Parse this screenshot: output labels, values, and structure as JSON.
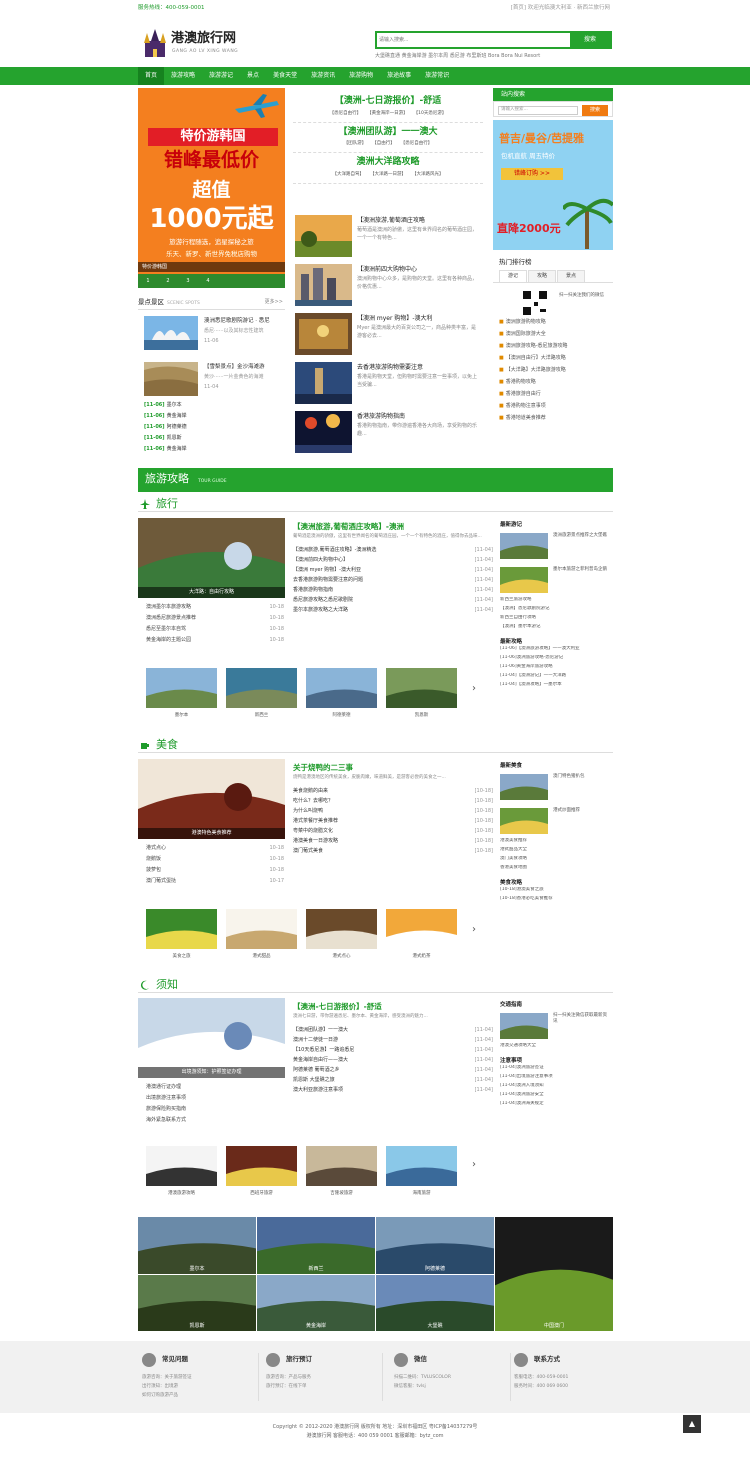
{
  "topbar": {
    "left": "服务热线：400-059-0001",
    "right": "[首页] 欢迎光临澳大利亚 · 新西兰旅行网"
  },
  "logo": {
    "cn": "港澳旅行网",
    "en": "GANG AO LV XING WANG"
  },
  "search": {
    "placeholder": "请输入搜索...",
    "button": "搜索",
    "hot": "大堡礁直通  黄金海岸游  墨尔本周  悉尼游  布里斯班  Bora Bora Nui Resort"
  },
  "nav": [
    "首页",
    "旅游攻略",
    "旅游游记",
    "景点",
    "美食天堂",
    "旅游资讯",
    "旅游购物",
    "旅途故事",
    "旅游常识"
  ],
  "banner": {
    "t1": "特价游韩国",
    "t2": "错峰最低价",
    "t3": "超值",
    "t4": "1000元起",
    "t5": "旅游行程随选，追星探秘之旅",
    "t6": "乐天、新罗、新世界免税店购物",
    "caption": "特价游韩国",
    "dots": [
      "1",
      "2",
      "3",
      "4"
    ]
  },
  "scenic": {
    "title": "景点景区",
    "en": "SCENIC SPOTS",
    "more": "更多>>",
    "items": [
      {
        "title": "澳洲悉尼歌剧院游记 · 悉尼",
        "desc": "悉尼······以及其标志性建筑",
        "date": "11-06"
      },
      {
        "title": "【雪梨景点】金沙海滩游",
        "desc": "黄沙······一片金黄色的海滩",
        "date": "11-04"
      }
    ],
    "list": [
      {
        "date": "[11-06]",
        "text": "墨尔本"
      },
      {
        "date": "[11-06]",
        "text": "黄金海岸"
      },
      {
        "date": "[11-06]",
        "text": "阿德莱德"
      },
      {
        "date": "[11-06]",
        "text": "凯恩斯"
      },
      {
        "date": "[11-06]",
        "text": "黄金海岸"
      }
    ]
  },
  "mid": {
    "blocks": [
      {
        "title": "【澳洲-七日游报价】-舒适",
        "subs": [
          "【悉尼自由行】",
          "【黄金海岸一日游】",
          "【10天悉尼游】"
        ]
      },
      {
        "title": "【澳洲团队游】一一澳大",
        "subs": [
          "【团队游】",
          "【自由行】",
          "【悉尼自由行】"
        ]
      },
      {
        "title": "澳洲大洋路攻略",
        "subs": [
          "【大洋路自驾】",
          "【大洋路一日游】",
          "【大洋路风光】"
        ]
      }
    ],
    "list": [
      {
        "title": "【澳洲旅游,葡萄酒庄攻略",
        "desc": "葡萄酒是澳洲的骄傲，这里有世界闻名的葡萄酒庄园，一个一个有特色..."
      },
      {
        "title": "【澳洲前四大购物中心",
        "desc": "澳洲购物中心众多，是购物的天堂。这里有各种商品，价格优惠..."
      },
      {
        "title": "【澳洲 myer 购物】-澳大利",
        "desc": "Myer 是澳洲最大的百货公司之一，商品种类丰富，是游客必去..."
      },
      {
        "title": "去香港旅游购物需要注意",
        "desc": "香港是购物天堂，但购物时需要注意一些事项，以免上当受骗..."
      },
      {
        "title": "香港旅游购物指南",
        "desc": "香港购物指南，带你游遍香港各大商场，享受购物的乐趣..."
      }
    ]
  },
  "right": {
    "search_title": "站内搜索",
    "search_ph": "请输入搜索...",
    "search_btn": "搜索",
    "ad_title": "普吉/曼谷/芭提雅",
    "ad_sub": "包机直航 周五特价",
    "ad_btn": "错峰订购 >>",
    "ad_price": "直降2000元",
    "rank_title": "热门排行榜",
    "tabs": [
      "游记",
      "攻略",
      "景点"
    ],
    "qr_text": "扫一扫关注我们的微信",
    "rank": [
      "澳洲旅游购物攻略",
      "澳洲国际旅游大全",
      "澳洲旅游攻略-悉尼旅游攻略",
      "【澳洲自由行】大洋路攻略",
      "【大洋路】大洋路旅游攻略",
      "香港购物攻略",
      "香港旅游自由行",
      "香港购物注意事项",
      "香港地道美食推荐"
    ]
  },
  "tourguide": {
    "title": "旅游攻略",
    "en": "TOUR GUIDE"
  },
  "cats": [
    {
      "name": "旅行",
      "img_cap": "大洋路：自由行攻略",
      "list": [
        {
          "t": "澳洲墨尔本旅游攻略",
          "d": "10-18"
        },
        {
          "t": "澳洲悉尼旅游景点推荐",
          "d": "10-18"
        },
        {
          "t": "悉尼至墨尔本自驾",
          "d": "10-18"
        },
        {
          "t": "黄金海岸的主题公园",
          "d": "10-18"
        }
      ],
      "center_title": "【澳洲旅游,葡萄酒庄攻略】-澳洲",
      "center_desc": "葡萄酒是澳洲的骄傲，这里有世界闻名的葡萄酒庄园，一个一个有特色的酒庄，值得你去品味...",
      "center_list": [
        {
          "t": "【澳洲旅游,葡萄酒庄攻略】-澳洲精选",
          "d": "[11-04]"
        },
        {
          "t": "【澳洲前四大购物中心】",
          "d": "[11-04]"
        },
        {
          "t": "【澳洲 myer 购物】-澳大利亚",
          "d": "[11-04]"
        },
        {
          "t": "去香港旅游购物需要注意的问题",
          "d": "[11-04]"
        },
        {
          "t": "香港旅游购物指南",
          "d": "[11-04]"
        },
        {
          "t": "悉尼旅游攻略之悉尼歌剧院",
          "d": "[11-04]"
        },
        {
          "t": "墨尔本旅游攻略之大洋路",
          "d": "[11-04]"
        }
      ],
      "right_title": "最新游记",
      "right_rows": [
        {
          "t": "澳洲旅游景点推荐之大堡礁"
        },
        {
          "t": "墨尔本旅游之菲利普岛企鹅"
        }
      ],
      "right_list": [
        "新西兰旅游攻略",
        "【澳洲】悉尼歌剧院游记",
        "新西兰自由行攻略",
        "【澳洲】墨尔本游记"
      ],
      "right_title2": "最新攻略",
      "right_list2": [
        "[11-06]【澳洲旅游攻略】一一澳大利亚",
        "[11-06]澳洲旅游攻略-悉尼游记",
        "[11-06]黄金海岸旅游攻略",
        "[11-04]【澳洲游记】一一大洋路",
        "[11-04]【澳洲攻略】一墨尔本"
      ],
      "thumbs": [
        "墨尔本",
        "新西兰",
        "阿德莱德",
        "凯恩斯"
      ]
    },
    {
      "name": "美食",
      "img_cap": "港澳特色美食推荐",
      "list": [
        {
          "t": "港式点心",
          "d": "10-18"
        },
        {
          "t": "烧鹅饭",
          "d": "10-18"
        },
        {
          "t": "菠萝包",
          "d": "10-18"
        },
        {
          "t": "澳门葡式蛋挞",
          "d": "10-17"
        }
      ],
      "center_title": "关于烧鸭的二三事",
      "center_desc": "烧鸭是港澳地区的传统美食，皮脆肉嫩，味道鲜美，是游客必尝的美食之一...",
      "center_list": [
        {
          "t": "美食烧鹅的由来",
          "d": "[10-18]"
        },
        {
          "t": "吃什么？去哪吃？",
          "d": "[10-18]"
        },
        {
          "t": "为什么叫烧鸭",
          "d": "[10-18]"
        },
        {
          "t": "港式茶餐厅美食推荐",
          "d": "[10-18]"
        },
        {
          "t": "粤菜中的烧腊文化",
          "d": "[10-18]"
        },
        {
          "t": "港澳美食一日游攻略",
          "d": "[10-18]"
        },
        {
          "t": "澳门葡式美食",
          "d": "[10-18]"
        }
      ],
      "right_title": "最新美食",
      "right_rows": [
        {
          "t": "澳门特色猪扒包"
        },
        {
          "t": "港式炒面推荐"
        }
      ],
      "right_list": [
        "港澳美食推荐",
        "港式甜品大全",
        "澳门美食攻略",
        "香港美食地图"
      ],
      "right_title2": "美食攻略",
      "right_list2": [
        "[10-18]港澳美食之旅",
        "[10-18]香港必吃美食推荐"
      ],
      "thumbs": [
        "美食之旅",
        "港式甜品",
        "港式点心",
        "港式奶茶"
      ]
    },
    {
      "name": "须知",
      "img_cap": "出境游须知：护照签证办理",
      "list": [
        {
          "t": "港澳通行证办理",
          "d": ""
        },
        {
          "t": "出境旅游注意事项",
          "d": ""
        },
        {
          "t": "旅游保险购买指南",
          "d": ""
        },
        {
          "t": "海外紧急联系方式",
          "d": ""
        }
      ],
      "center_title": "【澳洲-七日游报价】-舒适",
      "center_desc": "澳洲七日游，带你游遍悉尼、墨尔本、黄金海岸，感受澳洲的魅力...",
      "center_list": [
        {
          "t": "【澳洲团队游】一一澳大",
          "d": "[11-04]"
        },
        {
          "t": "澳洲十二使徒一日游",
          "d": "[11-04]"
        },
        {
          "t": "【10天悉尼游】一路追悉尼",
          "d": "[11-04]"
        },
        {
          "t": "黄金海岸自由行——澳大",
          "d": "[11-04]"
        },
        {
          "t": "阿德莱德 葡萄酒之乡",
          "d": "[11-04]"
        },
        {
          "t": "凯恩斯 大堡礁之旅",
          "d": "[11-04]"
        },
        {
          "t": "澳大利亚旅游注意事项",
          "d": "[11-04]"
        }
      ],
      "right_title": "交通指南",
      "right_rows": [
        {
          "t": "扫一扫关注微信获取最新资讯"
        }
      ],
      "right_list": [
        "港澳交通攻略大全"
      ],
      "right_title2": "注意事项",
      "right_list2": [
        "[11-04]澳洲旅游签证",
        "[11-04]出境旅游注意事项",
        "[11-04]澳洲入境须知",
        "[11-04]澳洲旅游安全",
        "[11-04]澳洲海关规定"
      ],
      "thumbs": [
        "港澳旅游攻略",
        "西班牙旅游",
        "吉隆坡旅游",
        "海南旅游"
      ]
    }
  ],
  "gallery": [
    "墨尔本",
    "新西兰",
    "阿德莱德",
    "凯恩斯",
    "黄金海岸",
    "大堡礁",
    "中国澳门"
  ],
  "footer": [
    {
      "title": "常见问题",
      "lines": [
        "旅游咨询：关于旅游签证",
        "出行须知：出境游",
        "如何订购旅游产品"
      ]
    },
    {
      "title": "旅行预订",
      "lines": [
        "旅游咨询：产品与服务",
        "旅行预订：在线下单"
      ]
    },
    {
      "title": "微信",
      "lines": [
        "扫描二维码：TVLUSCOLOR",
        "微信客服：tvlsj"
      ]
    },
    {
      "title": "联系方式",
      "lines": [
        "客服电话：400-059-0001",
        "服务时间：400 069 0600"
      ]
    }
  ],
  "copyright": [
    "Copyright © 2012-2020 港澳旅行网 版权所有 地址：深圳市福田区 粤ICP备14037279号",
    "港澳旅行网  客服电话：400 059 0001  客服邮箱：bytz_com"
  ],
  "colors": {
    "brand": "#25a32e",
    "orange": "#f07a10"
  }
}
